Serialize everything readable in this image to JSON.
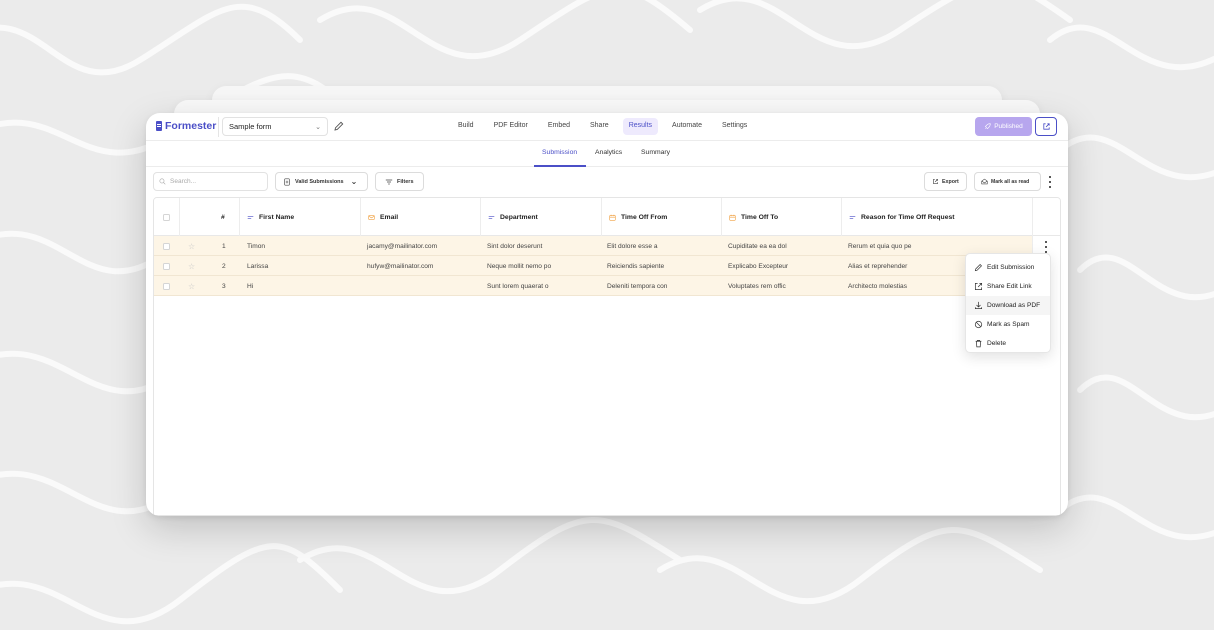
{
  "header": {
    "logo": "Formester",
    "form_name": "Sample form",
    "nav": [
      {
        "label": "Build",
        "active": false
      },
      {
        "label": "PDF Editor",
        "active": false
      },
      {
        "label": "Embed",
        "active": false
      },
      {
        "label": "Share",
        "active": false
      },
      {
        "label": "Results",
        "active": true
      },
      {
        "label": "Automate",
        "active": false
      },
      {
        "label": "Settings",
        "active": false
      }
    ],
    "published_label": "Published"
  },
  "subtabs": [
    {
      "label": "Submission",
      "active": true
    },
    {
      "label": "Analytics",
      "active": false
    },
    {
      "label": "Summary",
      "active": false
    }
  ],
  "toolbar": {
    "search_placeholder": "Search...",
    "filter_select": "Valid Submissions",
    "filters_label": "Filters",
    "export_label": "Export",
    "mark_all_label": "Mark all as read"
  },
  "table": {
    "columns": [
      {
        "key": "num",
        "label": "#",
        "icon": "none"
      },
      {
        "key": "first_name",
        "label": "First Name",
        "icon": "short-text-icon"
      },
      {
        "key": "email",
        "label": "Email",
        "icon": "mail-icon"
      },
      {
        "key": "department",
        "label": "Department",
        "icon": "short-text-icon"
      },
      {
        "key": "time_off_from",
        "label": "Time Off From",
        "icon": "calendar-icon"
      },
      {
        "key": "time_off_to",
        "label": "Time Off To",
        "icon": "calendar-icon"
      },
      {
        "key": "reason",
        "label": "Reason for Time Off Request",
        "icon": "short-text-icon"
      }
    ],
    "rows": [
      {
        "num": "1",
        "first_name": "Timon",
        "email": "jacamy@mailinator.com",
        "department": "Sint dolor deserunt",
        "time_off_from": "Elit dolore esse a",
        "time_off_to": "Cupiditate ea ea dol",
        "reason": "Rerum et quia quo pe"
      },
      {
        "num": "2",
        "first_name": "Larissa",
        "email": "hufyw@mailinator.com",
        "department": "Neque mollit nemo po",
        "time_off_from": "Reiciendis sapiente",
        "time_off_to": "Explicabo Excepteur",
        "reason": "Alias et reprehender"
      },
      {
        "num": "3",
        "first_name": "Hi",
        "email": "",
        "department": "Sunt lorem quaerat o",
        "time_off_from": "Deleniti tempora con",
        "time_off_to": "Voluptates rem offic",
        "reason": "Architecto molestias"
      }
    ]
  },
  "row_menu": {
    "items": [
      {
        "label": "Edit Submission",
        "icon": "pencil-icon"
      },
      {
        "label": "Share Edit Link",
        "icon": "external-link-icon"
      },
      {
        "label": "Download as PDF",
        "icon": "download-icon"
      },
      {
        "label": "Mark as Spam",
        "icon": "ban-icon"
      },
      {
        "label": "Delete",
        "icon": "trash-icon"
      }
    ]
  },
  "colors": {
    "brand": "#4b4fc7",
    "published_bg": "#b7a6ee",
    "row_highlight": "#fdf5e6",
    "tab_active_bg": "#eeeafd",
    "accent_orange": "#f0a040"
  }
}
